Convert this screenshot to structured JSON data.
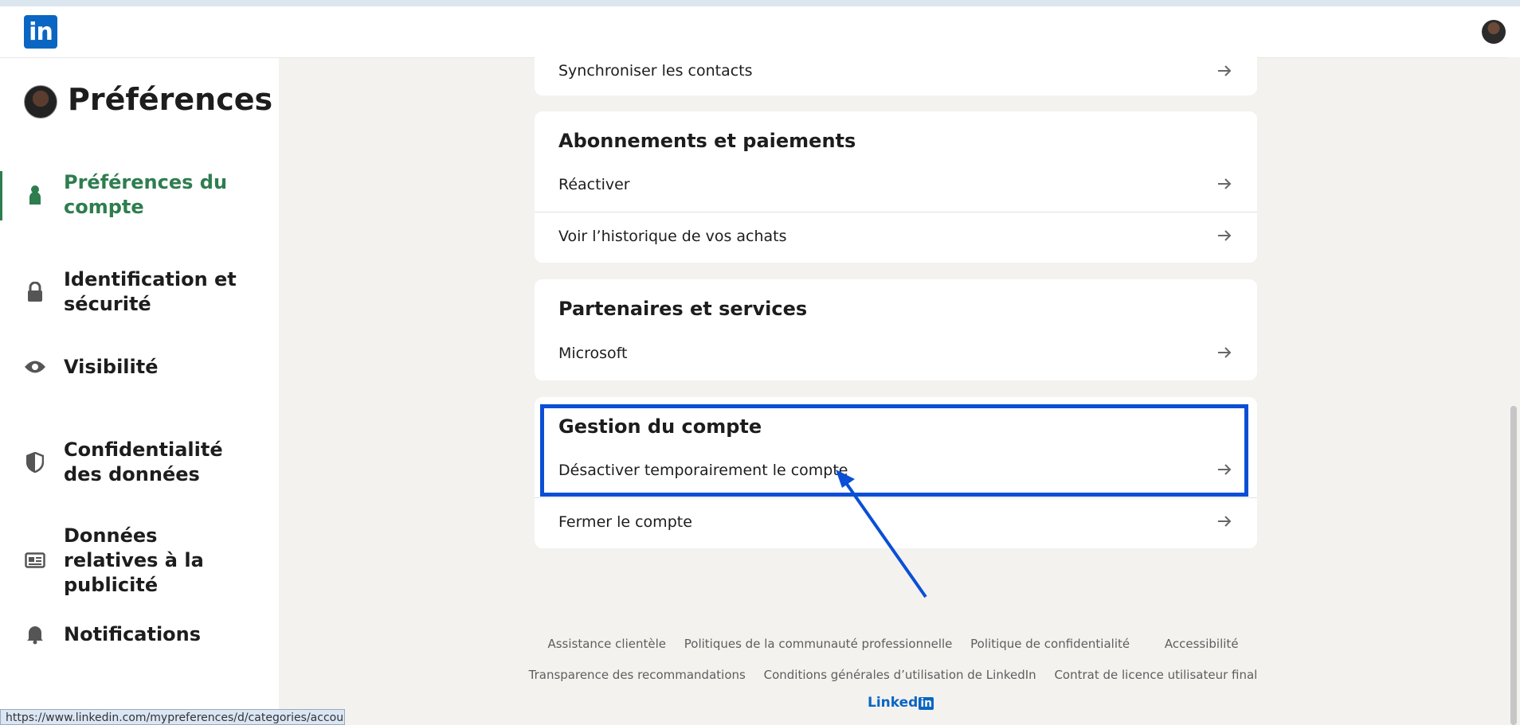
{
  "header": {
    "logo_text": "in"
  },
  "sidebar": {
    "title": "Préférences",
    "items": [
      {
        "label": "Préférences du compte",
        "icon": "person-icon",
        "active": true
      },
      {
        "label": "Identification et sécurité",
        "icon": "lock-icon"
      },
      {
        "label": "Visibilité",
        "icon": "eye-icon"
      },
      {
        "label": "Confidentialité des données",
        "icon": "shield-icon"
      },
      {
        "label": "Données relatives à la publicité",
        "icon": "newspaper-icon"
      },
      {
        "label": "Notifications",
        "icon": "bell-icon"
      }
    ]
  },
  "sections": {
    "sync": {
      "row": "Synchroniser les contacts"
    },
    "subscriptions": {
      "title": "Abonnements et paiements",
      "rows": [
        "Réactiver",
        "Voir l’historique de vos achats"
      ]
    },
    "partners": {
      "title": "Partenaires et services",
      "rows": [
        "Microsoft"
      ]
    },
    "account": {
      "title": "Gestion du compte",
      "rows": [
        "Désactiver temporairement le compte",
        "Fermer le compte"
      ]
    }
  },
  "footer": {
    "links_row1": [
      "Assistance clientèle",
      "Politiques de la communauté professionnelle",
      "Politique de confidentialité",
      "Accessibilité"
    ],
    "links_row2": [
      "Transparence des recommandations",
      "Conditions générales d’utilisation de LinkedIn",
      "Contrat de licence utilisateur final"
    ],
    "logo_text": "Linked",
    "logo_box": "in"
  },
  "statusbar": {
    "url": "https://www.linkedin.com/mypreferences/d/categories/account"
  },
  "colors": {
    "accent_green": "#2e7d4f",
    "linkedin_blue": "#0a66c2",
    "annotation_blue": "#0a4fd6"
  }
}
